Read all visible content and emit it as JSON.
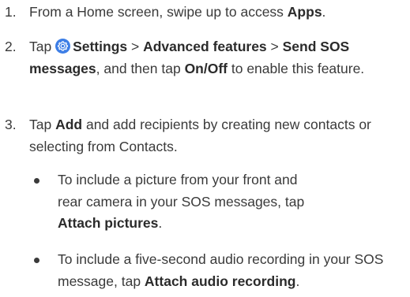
{
  "steps": [
    {
      "number": "1.",
      "pre": "From a Home screen, swipe up to access ",
      "bold1": "Apps",
      "post": "."
    },
    {
      "number": "2.",
      "tap": "Tap ",
      "icon": "settings-gear-icon",
      "settings": "Settings",
      "sep1": " > ",
      "advanced": "Advanced features",
      "sep2": " > ",
      "sendsos": "Send SOS messages",
      "mid": ", and then tap ",
      "onoff": "On/Off",
      "tail": " to enable this feature."
    },
    {
      "number": "3.",
      "tap": "Tap ",
      "add": "Add",
      "rest": " and add recipients by creating new contacts or selecting from Contacts."
    }
  ],
  "bullets": [
    {
      "pre": "To include a picture from your front and rear camera in your SOS messages, tap ",
      "bold": "Attach pictures",
      "post": "."
    },
    {
      "pre": "To include a five-second audio recording in your SOS message, tap ",
      "bold": "Attach audio recording",
      "post": "."
    }
  ],
  "colors": {
    "text": "#3a3a3a",
    "icon_accent": "#3d7ee6"
  }
}
